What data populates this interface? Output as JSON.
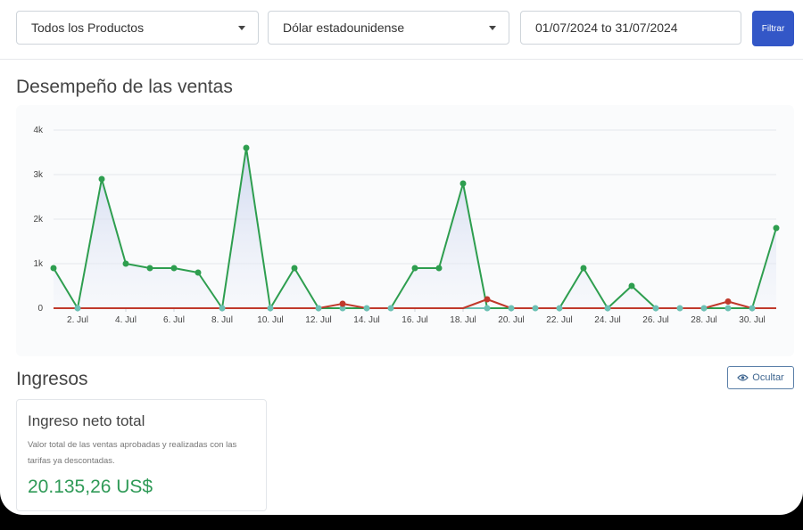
{
  "toolbar": {
    "product_select": "Todos los Productos",
    "currency_select": "Dólar estadounidense",
    "date_range": "01/07/2024 to 31/07/2024",
    "filter_label": "Filtrar"
  },
  "sales": {
    "title": "Desempeño de las ventas"
  },
  "chart_data": {
    "type": "line",
    "y_ticks": [
      "0",
      "1k",
      "2k",
      "3k",
      "4k"
    ],
    "ylim": [
      0,
      4000
    ],
    "x_ticks": [
      "2. Jul",
      "4. Jul",
      "6. Jul",
      "8. Jul",
      "10. Jul",
      "12. Jul",
      "14. Jul",
      "16. Jul",
      "18. Jul",
      "20. Jul",
      "22. Jul",
      "24. Jul",
      "26. Jul",
      "28. Jul",
      "30. Jul"
    ],
    "x": [
      1,
      2,
      3,
      4,
      5,
      6,
      7,
      8,
      9,
      10,
      11,
      12,
      13,
      14,
      15,
      16,
      17,
      18,
      19,
      20,
      21,
      22,
      23,
      24,
      25,
      26,
      27,
      28,
      29,
      30,
      31
    ],
    "series": [
      {
        "color": "#2e9e4f",
        "values": [
          900,
          0,
          2900,
          1000,
          900,
          900,
          800,
          0,
          3600,
          0,
          900,
          0,
          0,
          0,
          0,
          900,
          900,
          2800,
          0,
          0,
          0,
          0,
          900,
          0,
          500,
          0,
          0,
          0,
          0,
          0,
          1800
        ]
      },
      {
        "color": "#c0392b",
        "values": [
          0,
          0,
          0,
          0,
          0,
          0,
          0,
          0,
          0,
          0,
          0,
          0,
          100,
          0,
          0,
          0,
          0,
          0,
          200,
          0,
          0,
          0,
          0,
          0,
          0,
          0,
          0,
          0,
          150,
          0,
          0
        ]
      }
    ],
    "grid": true
  },
  "revenue": {
    "title": "Ingresos",
    "hide_label": "Ocultar",
    "card_title": "Ingreso neto total",
    "card_desc": "Valor total de las ventas aprobadas y realizadas con las tarifas ya descontadas.",
    "card_value": "20.135,26 US$"
  }
}
